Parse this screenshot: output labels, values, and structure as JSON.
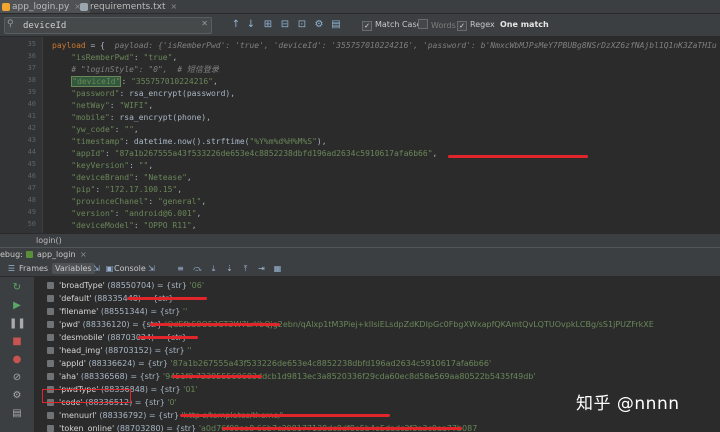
{
  "tabs": [
    {
      "label": "app_login.py",
      "color": "#f0a732"
    },
    {
      "label": "requirements.txt",
      "color": "#9aa7b0"
    }
  ],
  "find": {
    "query": "deviceId",
    "match_case": "Match Case",
    "words": "Words",
    "regex": "Regex",
    "result": "One match"
  },
  "code_lines": [
    {
      "n": "35",
      "segs": [
        [
          "k",
          "payload"
        ],
        [
          "",
          " = {  "
        ],
        [
          "c",
          "payload: {'isRemberPwd': 'true', 'deviceId': '355757010224216', 'password': b'NmxcWbMJPsMeY7PBUBg8NSrDzXZ6zfNAjbl1Q1nK3ZaTHIu"
        ]
      ]
    },
    {
      "n": "36",
      "segs": [
        [
          "s",
          "    \"isRemberPwd\""
        ],
        [
          "",
          ": "
        ],
        [
          "s",
          "\"true\""
        ],
        [
          "",
          ","
        ]
      ]
    },
    {
      "n": "37",
      "segs": [
        [
          "c",
          "    # \"loginStyle\": \"0\",  # 短信登录"
        ]
      ]
    },
    {
      "n": "38",
      "segs": [
        [
          "",
          "    "
        ],
        [
          "h",
          "\"deviceId\""
        ],
        [
          "",
          ": "
        ],
        [
          "s",
          "\"355757010224216\""
        ],
        [
          "",
          ","
        ]
      ]
    },
    {
      "n": "39",
      "segs": [
        [
          "s",
          "    \"password\""
        ],
        [
          "",
          ": rsa_encrypt(password),"
        ]
      ]
    },
    {
      "n": "40",
      "segs": [
        [
          "s",
          "    \"netWay\""
        ],
        [
          "",
          ": "
        ],
        [
          "s",
          "\"WIFI\""
        ],
        [
          "",
          ","
        ]
      ]
    },
    {
      "n": "41",
      "segs": [
        [
          "s",
          "    \"mobile\""
        ],
        [
          "",
          ": rsa_encrypt(phone),"
        ]
      ]
    },
    {
      "n": "42",
      "segs": [
        [
          "s",
          "    \"yw_code\""
        ],
        [
          "",
          ": "
        ],
        [
          "s",
          "\"\""
        ],
        [
          "",
          ","
        ]
      ]
    },
    {
      "n": "43",
      "segs": [
        [
          "s",
          "    \"timestamp\""
        ],
        [
          "",
          ": datetime.now().strftime("
        ],
        [
          "s",
          "\"%Y%m%d%H%M%S\""
        ],
        [
          "",
          "),"
        ]
      ]
    },
    {
      "n": "44",
      "segs": [
        [
          "s",
          "    \"appId\""
        ],
        [
          "",
          ": "
        ],
        [
          "s",
          "\"87a1b267555a43f533226de653e4c8852238dbfd196ad2634c5910617afa6b66\""
        ],
        [
          "",
          ","
        ]
      ]
    },
    {
      "n": "45",
      "segs": [
        [
          "s",
          "    \"keyVersion\""
        ],
        [
          "",
          ": "
        ],
        [
          "s",
          "\"\""
        ],
        [
          "",
          ","
        ]
      ]
    },
    {
      "n": "46",
      "segs": [
        [
          "s",
          "    \"deviceBrand\""
        ],
        [
          "",
          ": "
        ],
        [
          "s",
          "\"Netease\""
        ],
        [
          "",
          ","
        ]
      ]
    },
    {
      "n": "47",
      "segs": [
        [
          "s",
          "    \"pip\""
        ],
        [
          "",
          ": "
        ],
        [
          "s",
          "\"172.17.100.15\""
        ],
        [
          "",
          ","
        ]
      ]
    },
    {
      "n": "48",
      "segs": [
        [
          "s",
          "    \"provinceChanel\""
        ],
        [
          "",
          ": "
        ],
        [
          "s",
          "\"general\""
        ],
        [
          "",
          ","
        ]
      ]
    },
    {
      "n": "49",
      "segs": [
        [
          "s",
          "    \"version\""
        ],
        [
          "",
          ": "
        ],
        [
          "s",
          "\"android@6.001\""
        ],
        [
          "",
          ","
        ]
      ]
    },
    {
      "n": "50",
      "segs": [
        [
          "s",
          "    \"deviceModel\""
        ],
        [
          "",
          ": "
        ],
        [
          "s",
          "\"OPPO R11\""
        ],
        [
          "",
          ","
        ]
      ]
    }
  ],
  "breadcrumb": "login()",
  "debug": {
    "label": "ebug:",
    "config": "app_login",
    "frames": "Frames",
    "variables": "Variables",
    "console": "Console"
  },
  "variables": [
    {
      "name": "'broadType'",
      "id": "(88550704)",
      "type": "{str}",
      "value": "'06'"
    },
    {
      "name": "'default'",
      "id": "(88335448)",
      "type": "{str}",
      "value": ""
    },
    {
      "name": "'filename'",
      "id": "(88551344)",
      "type": "{str}",
      "value": "''"
    },
    {
      "name": "'pwd'",
      "id": "(88336120)",
      "type": "{str}",
      "value": "'QdEfbS8O53CT3W7LrYbQjg2ebn/qAlxp1tM3Piej+klIsiELsdpZdKDIpGc0FbgXWxapfQKAmtQvLQTUOvpkLCBg/sS1jPUZFrkXE"
    },
    {
      "name": "'desmobile'",
      "id": "(88703024)",
      "type": "{str}",
      "value": ""
    },
    {
      "name": "'head_img'",
      "id": "(88703152)",
      "type": "{str}",
      "value": "''"
    },
    {
      "name": "'appId'",
      "id": "(88336624)",
      "type": "{str}",
      "value": "'87a1b267555a43f533226de653e4c8852238dbfd196ad2634c5910617afa6b66'"
    },
    {
      "name": "'aha'",
      "id": "(88336568)",
      "type": "{str}",
      "value": "'9451f0                          723955560683ddcb1d9813ec3a8520336f29cda60ec8d58e569aa80522b5435f49db'"
    },
    {
      "name": "'pwdType'",
      "id": "(88336848)",
      "type": "{str}",
      "value": "'01'"
    },
    {
      "name": "'code'",
      "id": "(88336512)",
      "type": "{str}",
      "value": "'0'"
    },
    {
      "name": "'menuurl'",
      "id": "(88336792)",
      "type": "{str}",
      "value": "'http                                                  s/templates/theme/'"
    },
    {
      "name": "'token_online'",
      "id": "(88703280)",
      "type": "{str}",
      "value": "'a0d76f09ea8                                                              66b7c398177138dc8df8e5b4e5dadc2f3a3c0aa77b087"
    }
  ],
  "watermark": "知乎 @nnnn",
  "colors": {
    "redaction": "#e0262a",
    "highlight": "#32593d"
  }
}
